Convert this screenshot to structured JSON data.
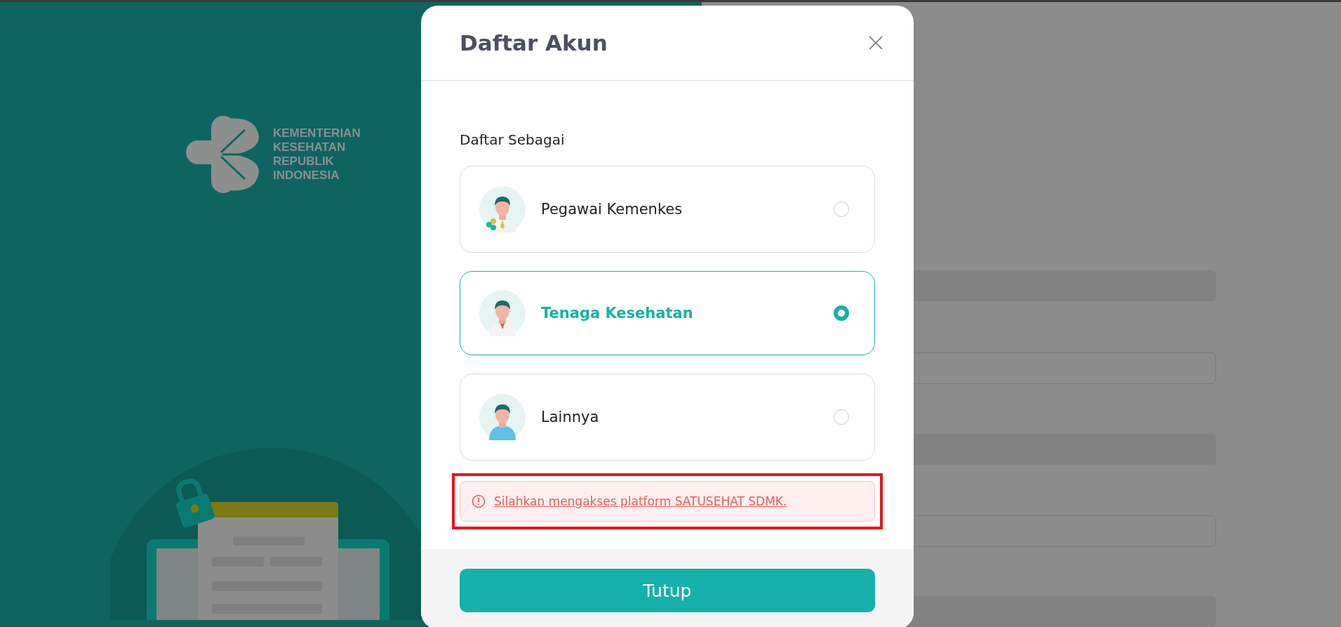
{
  "brand": {
    "lines": [
      "KEMENTERIAN",
      "KESEHATAN",
      "REPUBLIK",
      "INDONESIA"
    ]
  },
  "dialog": {
    "title": "Daftar Akun",
    "section_label": "Daftar Sebagai",
    "options": [
      {
        "kind": "employee",
        "label": "Pegawai Kemenkes",
        "selected": false
      },
      {
        "kind": "health-worker",
        "label": "Tenaga Kesehatan",
        "selected": true
      },
      {
        "kind": "other",
        "label": "Lainnya",
        "selected": false
      }
    ],
    "alert": {
      "text": "Silahkan mengakses platform SATUSEHAT SDMK.",
      "highlighted": true
    },
    "close_button": "Tutup"
  }
}
